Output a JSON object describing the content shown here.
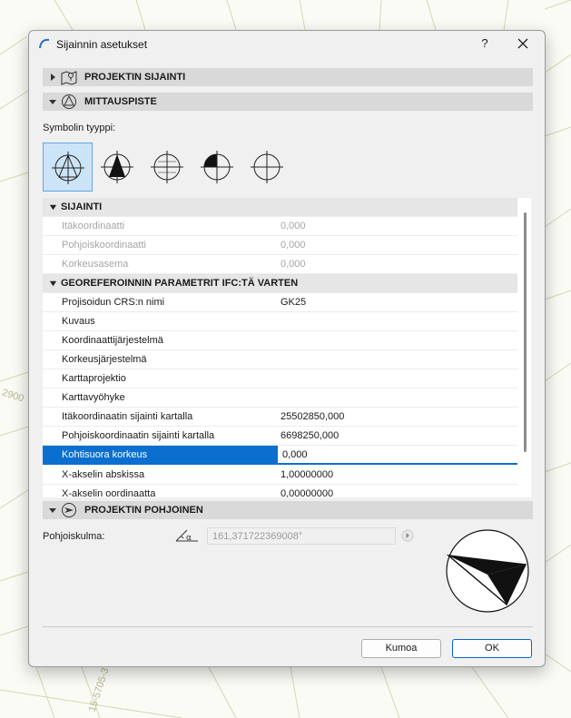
{
  "dialog": {
    "title": "Sijainnin asetukset",
    "help_label": "?",
    "close_icon": "close-icon"
  },
  "sections": {
    "project_location": "PROJEKTIN SIJAINTI",
    "survey_point": "MITTAUSPISTE",
    "project_north": "PROJEKTIN POHJOINEN"
  },
  "symbol": {
    "label": "Symbolin tyyppi:",
    "types": [
      "symbol-type-1",
      "symbol-type-2",
      "symbol-type-3",
      "symbol-type-4",
      "symbol-type-5"
    ],
    "selected_index": 0
  },
  "grid": {
    "groups": {
      "location": "SIJAINTI",
      "georef": "GEOREFEROINNIN PARAMETRIT IFC:TÄ VARTEN"
    },
    "location_rows": [
      {
        "label": "Itäkoordinaatti",
        "value": "0,000"
      },
      {
        "label": "Pohjoiskoordinaatti",
        "value": "0,000"
      },
      {
        "label": "Korkeusasema",
        "value": "0,000"
      }
    ],
    "georef_rows": [
      {
        "label": "Projisoidun CRS:n nimi",
        "value": "GK25"
      },
      {
        "label": "Kuvaus",
        "value": ""
      },
      {
        "label": "Koordinaattijärjestelmä",
        "value": ""
      },
      {
        "label": "Korkeusjärjestelmä",
        "value": ""
      },
      {
        "label": "Karttaprojektio",
        "value": ""
      },
      {
        "label": "Karttavyöhyke",
        "value": ""
      },
      {
        "label": "Itäkoordinaatin sijainti kartalla",
        "value": "25502850,000"
      },
      {
        "label": "Pohjoiskoordinaatin sijainti kartalla",
        "value": "6698250,000"
      },
      {
        "label": "Kohtisuora korkeus",
        "value": "0,000"
      },
      {
        "label": "X-akselin abskissa",
        "value": "1,00000000"
      },
      {
        "label": "X-akselin oordinaatta",
        "value": "0,00000000"
      }
    ]
  },
  "north": {
    "label": "Pohjoiskulma:",
    "angle_value": "161,371722369008°"
  },
  "buttons": {
    "cancel": "Kumoa",
    "ok": "OK"
  },
  "map": {
    "labels": [
      "2900",
      "15-5705-3"
    ]
  },
  "colors": {
    "accent": "#0a6fcf",
    "selected_symbol_bg": "#cce4f7",
    "section_header": "#d9d9d9"
  }
}
